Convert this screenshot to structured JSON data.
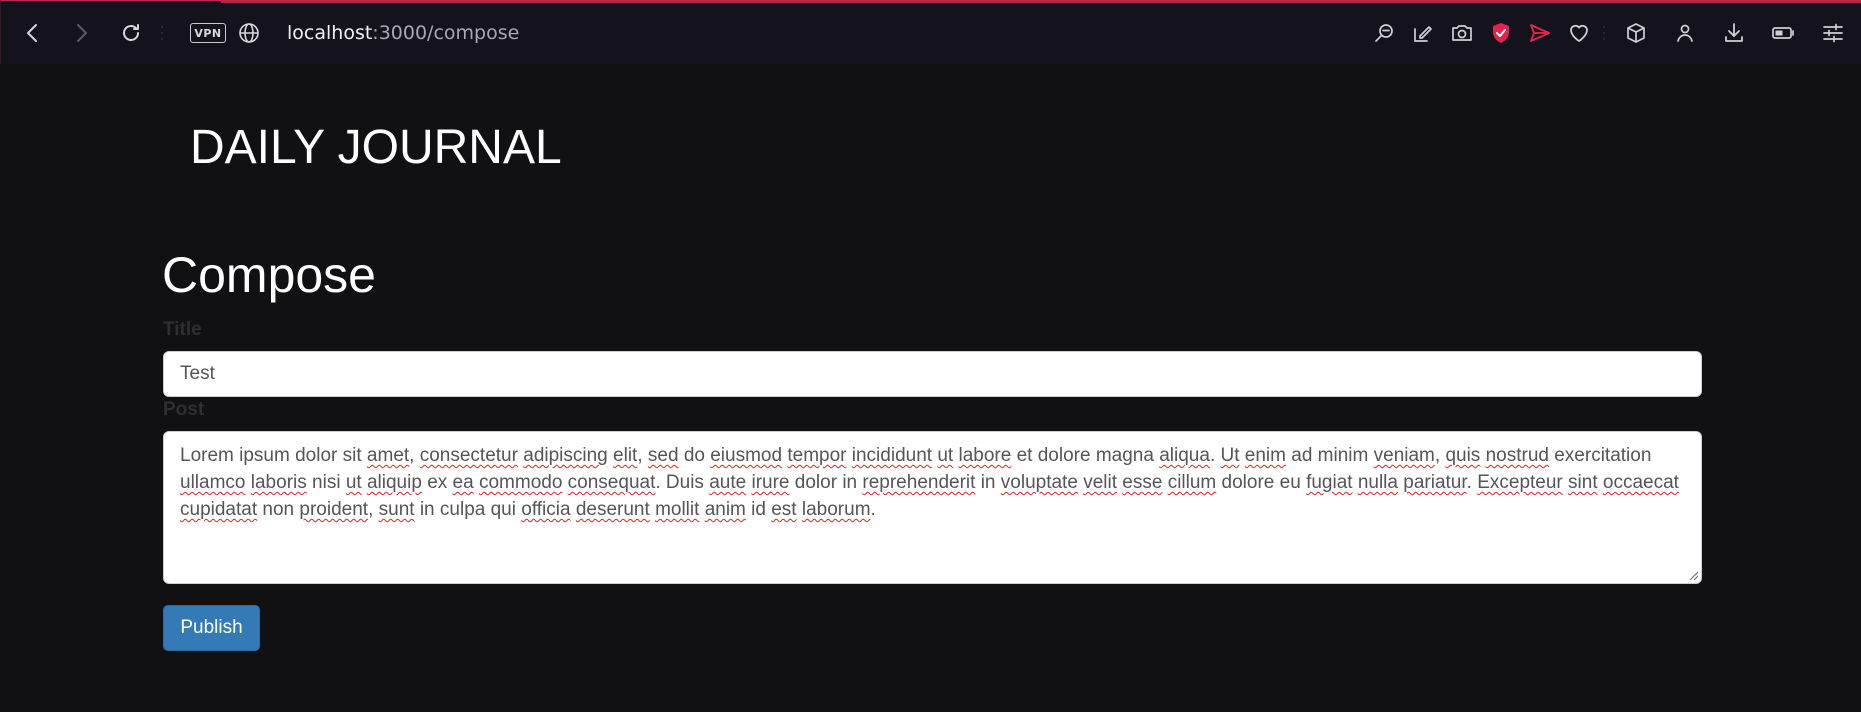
{
  "browser": {
    "vpn_label": "VPN",
    "url_host": "localhost",
    "url_path": ":3000/compose",
    "accent_color": "#e0244e",
    "toolbar_icons": [
      "search-icon",
      "snapshot-edit-icon",
      "camera-icon",
      "shield-icon",
      "send-icon",
      "heart-icon",
      "cube-icon",
      "account-icon",
      "download-icon",
      "battery-icon",
      "settings-sliders-icon"
    ]
  },
  "site": {
    "brand": "DAILY JOURNAL"
  },
  "compose": {
    "heading": "Compose",
    "title_label": "Title",
    "title_value": "Test",
    "post_label": "Post",
    "post_value": "Lorem ipsum dolor sit amet, consectetur adipiscing elit, sed do eiusmod tempor incididunt ut labore et dolore magna aliqua. Ut enim ad minim veniam, quis nostrud exercitation ullamco laboris nisi ut aliquip ex ea commodo consequat. Duis aute irure dolor in reprehenderit in voluptate velit esse cillum dolore eu fugiat nulla pariatur. Excepteur sint occaecat cupidatat non proident, sunt in culpa qui officia deserunt mollit anim id est laborum.",
    "publish_label": "Publish",
    "publish_color": "#337ab7"
  }
}
